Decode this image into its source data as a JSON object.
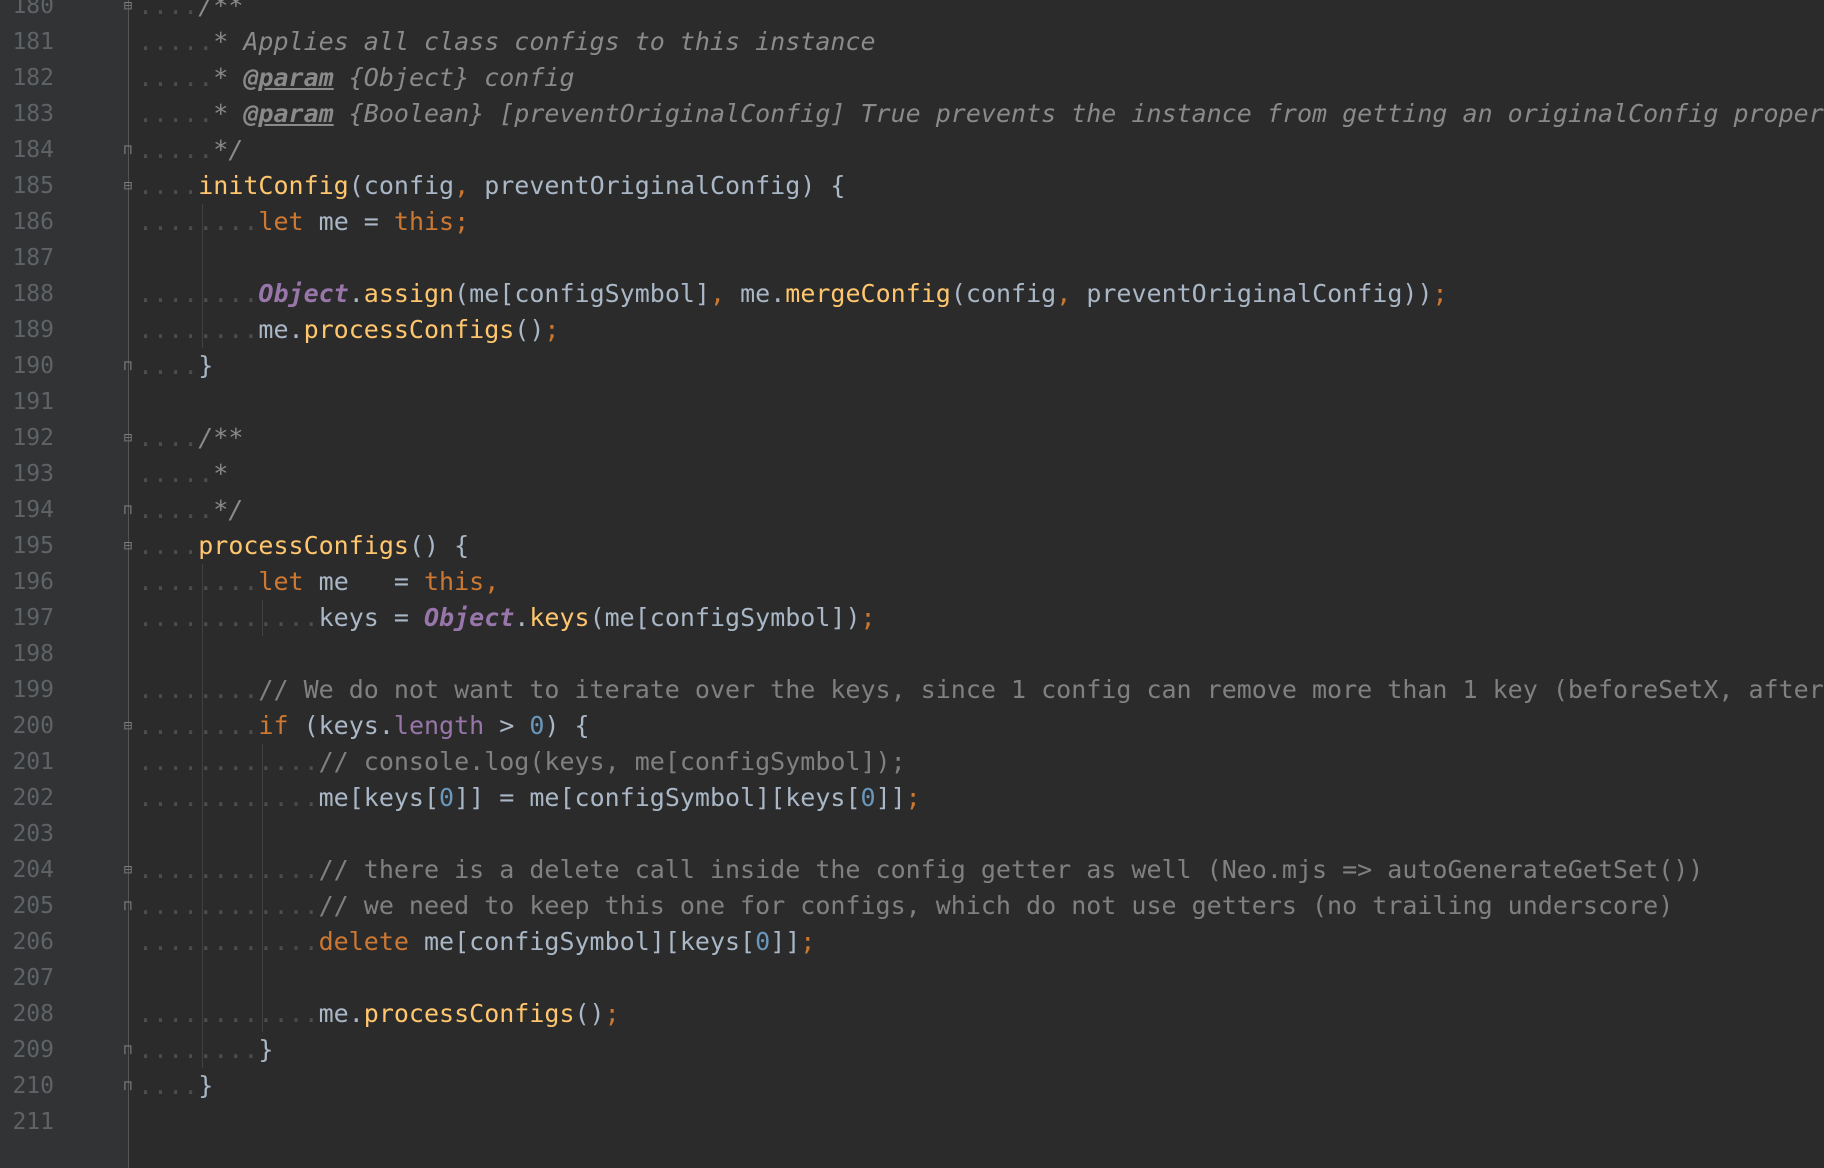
{
  "editor": {
    "colors": {
      "background": "#2b2b2b",
      "keyword": "#cc7832",
      "function": "#ffc66d",
      "comment": "#808080",
      "property": "#9876aa",
      "number": "#6897bb",
      "text": "#a9b7c6"
    },
    "lines": [
      {
        "n": "180",
        "fold": "fold-start",
        "segs": [
          [
            "ws",
            "...."
          ],
          [
            "doc",
            "/**"
          ]
        ]
      },
      {
        "n": "181",
        "fold": "",
        "segs": [
          [
            "ws",
            "....."
          ],
          [
            "doc",
            "* Applies all class configs to this instance"
          ]
        ]
      },
      {
        "n": "182",
        "fold": "",
        "segs": [
          [
            "ws",
            "....."
          ],
          [
            "doc",
            "* "
          ],
          [
            "tag",
            "@param"
          ],
          [
            "doc",
            " {Object} config"
          ]
        ]
      },
      {
        "n": "183",
        "fold": "",
        "segs": [
          [
            "ws",
            "....."
          ],
          [
            "doc",
            "* "
          ],
          [
            "tag",
            "@param"
          ],
          [
            "doc",
            " {Boolean} [preventOriginalConfig] True prevents the instance from getting an originalConfig property"
          ]
        ]
      },
      {
        "n": "184",
        "fold": "fold-end",
        "segs": [
          [
            "ws",
            "....."
          ],
          [
            "doc",
            "*/"
          ]
        ]
      },
      {
        "n": "185",
        "fold": "fold-start",
        "segs": [
          [
            "ws",
            "...."
          ],
          [
            "fn",
            "initConfig"
          ],
          [
            "p",
            "(config"
          ],
          [
            "kw",
            ","
          ],
          [
            "p",
            " preventOriginalConfig) {"
          ]
        ]
      },
      {
        "n": "186",
        "fold": "",
        "segs": [
          [
            "ws",
            "........"
          ],
          [
            "kw",
            "let "
          ],
          [
            "p",
            "me = "
          ],
          [
            "kw",
            "this;"
          ]
        ]
      },
      {
        "n": "187",
        "fold": "",
        "segs": [
          [
            "p",
            ""
          ]
        ]
      },
      {
        "n": "188",
        "fold": "",
        "segs": [
          [
            "ws",
            "........"
          ],
          [
            "obj",
            "Object"
          ],
          [
            "p",
            "."
          ],
          [
            "fn",
            "assign"
          ],
          [
            "p",
            "(me[configSymbol]"
          ],
          [
            "kw",
            ","
          ],
          [
            "p",
            " me."
          ],
          [
            "fn",
            "mergeConfig"
          ],
          [
            "p",
            "(config"
          ],
          [
            "kw",
            ","
          ],
          [
            "p",
            " preventOriginalConfig))"
          ],
          [
            "kw",
            ";"
          ]
        ]
      },
      {
        "n": "189",
        "fold": "",
        "segs": [
          [
            "ws",
            "........"
          ],
          [
            "p",
            "me."
          ],
          [
            "fn",
            "processConfigs"
          ],
          [
            "p",
            "()"
          ],
          [
            "kw",
            ";"
          ]
        ]
      },
      {
        "n": "190",
        "fold": "fold-end",
        "segs": [
          [
            "ws",
            "...."
          ],
          [
            "p",
            "}"
          ]
        ]
      },
      {
        "n": "191",
        "fold": "",
        "segs": [
          [
            "p",
            ""
          ]
        ]
      },
      {
        "n": "192",
        "fold": "fold-start",
        "segs": [
          [
            "ws",
            "...."
          ],
          [
            "doc",
            "/**"
          ]
        ]
      },
      {
        "n": "193",
        "fold": "",
        "segs": [
          [
            "ws",
            "....."
          ],
          [
            "doc",
            "*"
          ]
        ]
      },
      {
        "n": "194",
        "fold": "fold-end",
        "segs": [
          [
            "ws",
            "....."
          ],
          [
            "doc",
            "*/"
          ]
        ]
      },
      {
        "n": "195",
        "fold": "fold-start",
        "segs": [
          [
            "ws",
            "...."
          ],
          [
            "fn",
            "processConfigs"
          ],
          [
            "p",
            "() {"
          ]
        ]
      },
      {
        "n": "196",
        "fold": "",
        "segs": [
          [
            "ws",
            "........"
          ],
          [
            "kw",
            "let "
          ],
          [
            "p",
            "me   = "
          ],
          [
            "kw",
            "this,"
          ]
        ]
      },
      {
        "n": "197",
        "fold": "",
        "segs": [
          [
            "ws",
            "............"
          ],
          [
            "p",
            "keys = "
          ],
          [
            "obj",
            "Object"
          ],
          [
            "p",
            "."
          ],
          [
            "fn",
            "keys"
          ],
          [
            "p",
            "(me[configSymbol])"
          ],
          [
            "kw",
            ";"
          ]
        ]
      },
      {
        "n": "198",
        "fold": "",
        "segs": [
          [
            "p",
            ""
          ]
        ]
      },
      {
        "n": "199",
        "fold": "",
        "segs": [
          [
            "ws",
            "........"
          ],
          [
            "cmt",
            "// We do not want to iterate over the keys, since 1 config can remove more than 1 key (beforeSetX, afterSetX)"
          ]
        ]
      },
      {
        "n": "200",
        "fold": "fold-start",
        "segs": [
          [
            "ws",
            "........"
          ],
          [
            "kw",
            "if "
          ],
          [
            "p",
            "(keys."
          ],
          [
            "prop",
            "length"
          ],
          [
            "p",
            " > "
          ],
          [
            "num",
            "0"
          ],
          [
            "p",
            ") {"
          ]
        ]
      },
      {
        "n": "201",
        "fold": "",
        "segs": [
          [
            "ws",
            "............"
          ],
          [
            "cmt",
            "// console.log(keys, me[configSymbol]);"
          ]
        ]
      },
      {
        "n": "202",
        "fold": "",
        "segs": [
          [
            "ws",
            "............"
          ],
          [
            "p",
            "me[keys["
          ],
          [
            "num",
            "0"
          ],
          [
            "p",
            "]] = me[configSymbol][keys["
          ],
          [
            "num",
            "0"
          ],
          [
            "p",
            "]]"
          ],
          [
            "kw",
            ";"
          ]
        ]
      },
      {
        "n": "203",
        "fold": "",
        "segs": [
          [
            "p",
            ""
          ]
        ]
      },
      {
        "n": "204",
        "fold": "fold-start",
        "segs": [
          [
            "ws",
            "............"
          ],
          [
            "cmt",
            "// there is a delete call inside the config getter as well (Neo.mjs => autoGenerateGetSet())"
          ]
        ]
      },
      {
        "n": "205",
        "fold": "fold-end",
        "segs": [
          [
            "ws",
            "............"
          ],
          [
            "cmt",
            "// we need to keep this one for configs, which do not use getters (no trailing underscore)"
          ]
        ]
      },
      {
        "n": "206",
        "fold": "",
        "segs": [
          [
            "ws",
            "............"
          ],
          [
            "kw",
            "delete "
          ],
          [
            "p",
            "me[configSymbol][keys["
          ],
          [
            "num",
            "0"
          ],
          [
            "p",
            "]]"
          ],
          [
            "kw",
            ";"
          ]
        ]
      },
      {
        "n": "207",
        "fold": "",
        "segs": [
          [
            "p",
            ""
          ]
        ]
      },
      {
        "n": "208",
        "fold": "",
        "segs": [
          [
            "ws",
            "............"
          ],
          [
            "p",
            "me."
          ],
          [
            "fn",
            "processConfigs"
          ],
          [
            "p",
            "()"
          ],
          [
            "kw",
            ";"
          ]
        ]
      },
      {
        "n": "209",
        "fold": "fold-end",
        "segs": [
          [
            "ws",
            "........"
          ],
          [
            "p",
            "}"
          ]
        ]
      },
      {
        "n": "210",
        "fold": "fold-end",
        "segs": [
          [
            "ws",
            "...."
          ],
          [
            "p",
            "}"
          ]
        ]
      },
      {
        "n": "211",
        "fold": "",
        "segs": [
          [
            "p",
            ""
          ]
        ]
      }
    ]
  }
}
